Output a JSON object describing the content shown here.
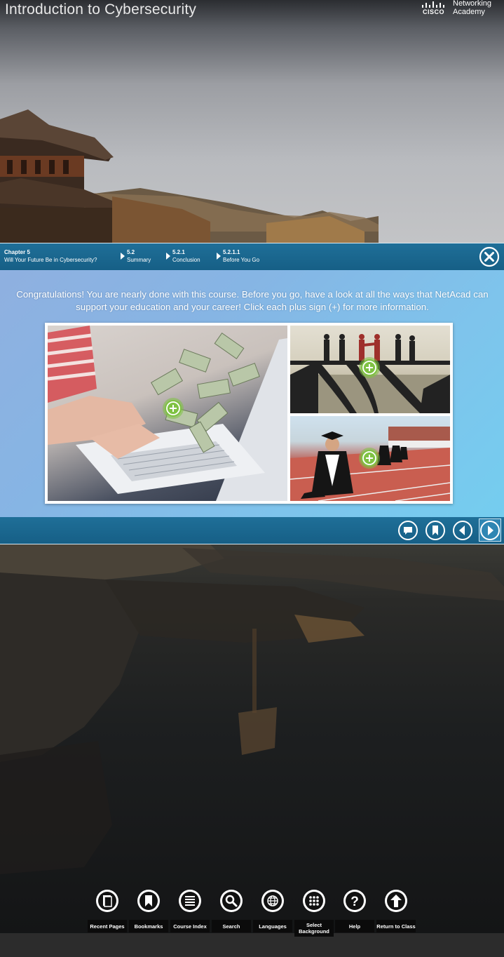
{
  "header": {
    "course_title": "Introduction to Cybersecurity",
    "logo": {
      "word": "CISCO",
      "line1": "Networking",
      "line2": "Academy"
    }
  },
  "breadcrumb": [
    {
      "top": "Chapter 5",
      "bottom": "Will Your Future Be in Cybersecurity?"
    },
    {
      "top": "5.2",
      "bottom": "Summary"
    },
    {
      "top": "5.2.1",
      "bottom": "Conclusion"
    },
    {
      "top": "5.2.1.1",
      "bottom": "Before You Go"
    }
  ],
  "content": {
    "intro_text": "Congratulations! You are nearly done with this course. Before you go, have a look at all the ways that NetAcad can support your education and your career! Click each plus sign (+) for more information."
  },
  "icons": {
    "close": "close-icon",
    "plus": "plus-icon",
    "comment": "comment-icon",
    "bookmark": "bookmark-icon",
    "prev": "previous-arrow-icon",
    "next": "next-arrow-icon"
  },
  "toolbar": [
    {
      "label": "Recent Pages",
      "icon": "recent-pages-icon"
    },
    {
      "label": "Bookmarks",
      "icon": "bookmark-icon"
    },
    {
      "label": "Course Index",
      "icon": "list-icon"
    },
    {
      "label": "Search",
      "icon": "search-icon"
    },
    {
      "label": "Languages",
      "icon": "globe-icon"
    },
    {
      "label": "Select Background",
      "icon": "grid-icon"
    },
    {
      "label": "Help",
      "icon": "help-icon"
    },
    {
      "label": "Return to Class",
      "icon": "return-arrow-icon"
    }
  ],
  "colors": {
    "bar_blue": "#1a6790",
    "plus_green": "#7fc243",
    "stage_blue": "#80bfe9"
  }
}
